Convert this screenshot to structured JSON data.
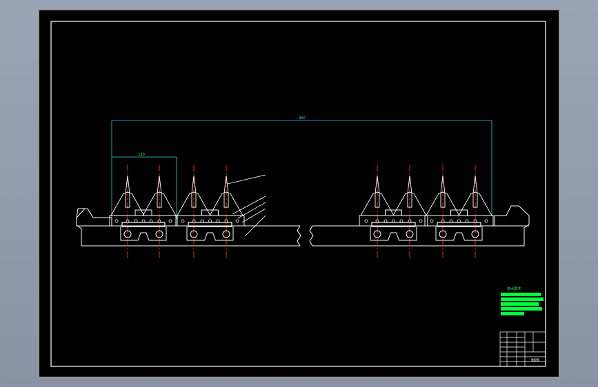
{
  "colors": {
    "frame": "#ffffff",
    "part": "#ffffff",
    "centerline": "#ff2a2a",
    "dimension": "#2ad4d4",
    "note": "#00ff3c",
    "background": "#000000"
  },
  "dimensions": {
    "overall": "900",
    "pitch": "150"
  },
  "notes": {
    "title": "技术要求"
  },
  "title_block": {
    "drawing_name": "装配图"
  }
}
